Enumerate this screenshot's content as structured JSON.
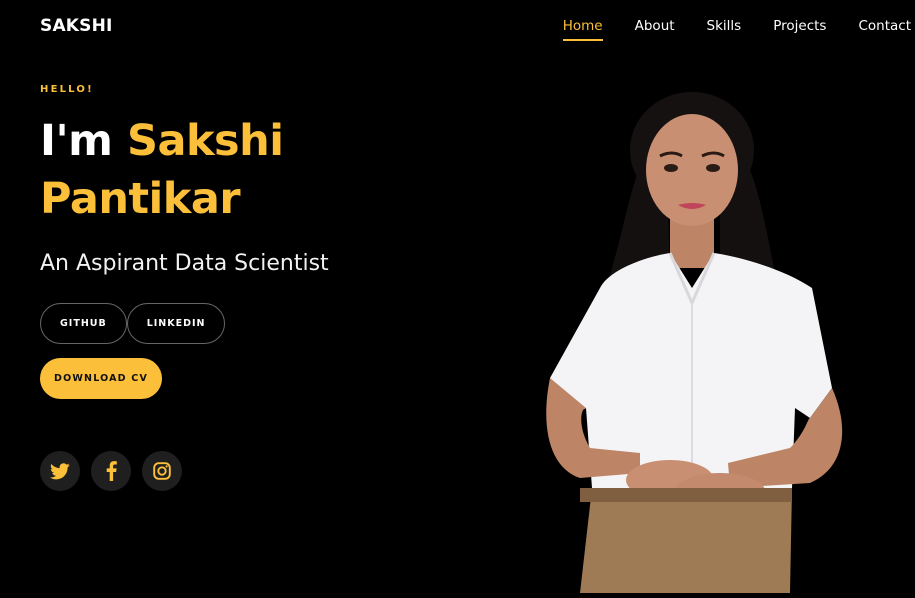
{
  "brand": "SAKSHI",
  "nav": {
    "home": "Home",
    "about": "About",
    "skills": "Skills",
    "projects": "Projects",
    "contact": "Contact"
  },
  "hero": {
    "greeting": "HELLO!",
    "intro": "I'm",
    "first_name": "Sakshi",
    "last_name": "Pantikar",
    "subtitle": "An Aspirant Data Scientist",
    "github_label": "GITHUB",
    "linkedin_label": "LINKEDIN",
    "download_label": "DOWNLOAD CV"
  },
  "socials": [
    {
      "icon": "twitter-icon"
    },
    {
      "icon": "facebook-icon"
    },
    {
      "icon": "instagram-icon"
    }
  ],
  "colors": {
    "accent": "#fbbf3a",
    "background": "#000000",
    "social_bg": "#1f1f1f"
  }
}
